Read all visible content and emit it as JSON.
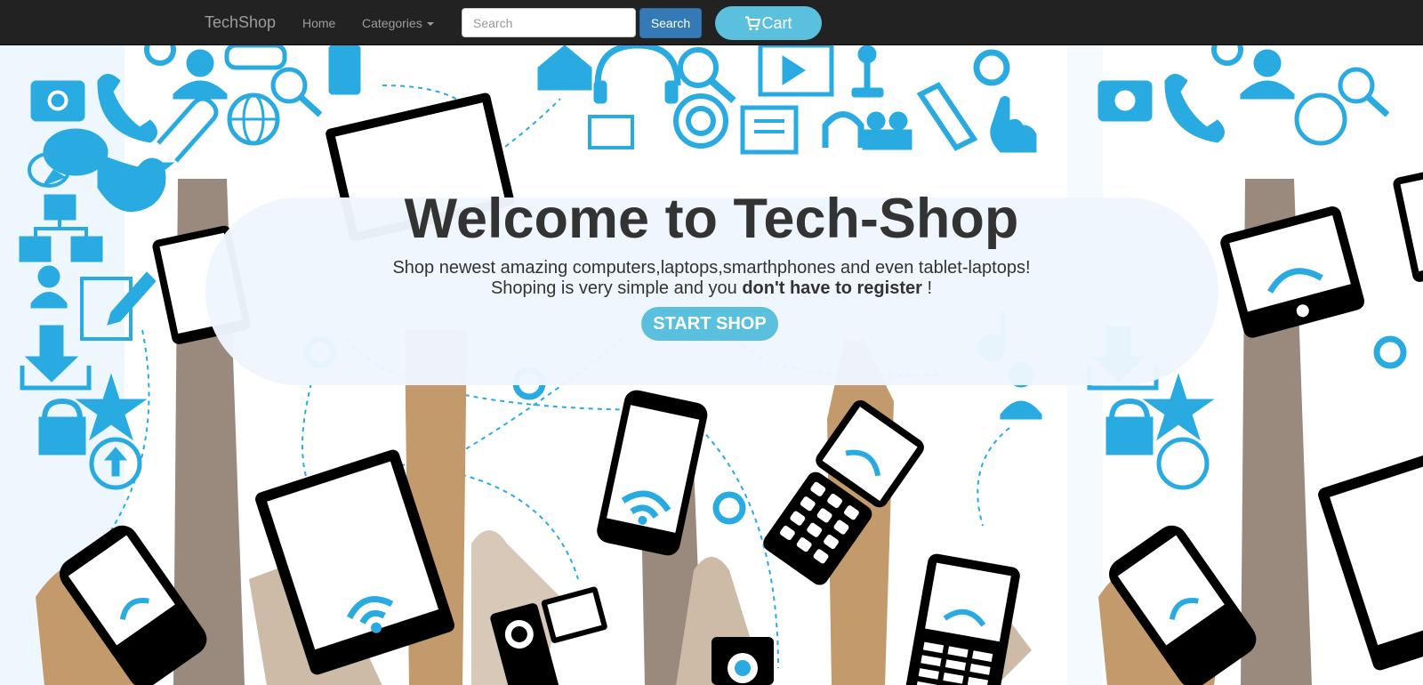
{
  "navbar": {
    "brand": "TechShop",
    "home": "Home",
    "categories": "Categories",
    "search_placeholder": "Search",
    "search_button": "Search",
    "cart_button": "Cart"
  },
  "hero": {
    "title": "Welcome to Tech-Shop",
    "line1": "Shop newest amazing computers,laptops,smarthphones and even tablet-laptops!",
    "line2_prefix": "Shoping is very simple and you ",
    "line2_bold": "don't have to register",
    "line2_suffix": " !",
    "start_button": "START SHOP"
  },
  "colors": {
    "navbar": "#222222",
    "accent_blue": "#29abe2",
    "button_primary": "#337ab7",
    "button_info": "#5bc0de"
  }
}
